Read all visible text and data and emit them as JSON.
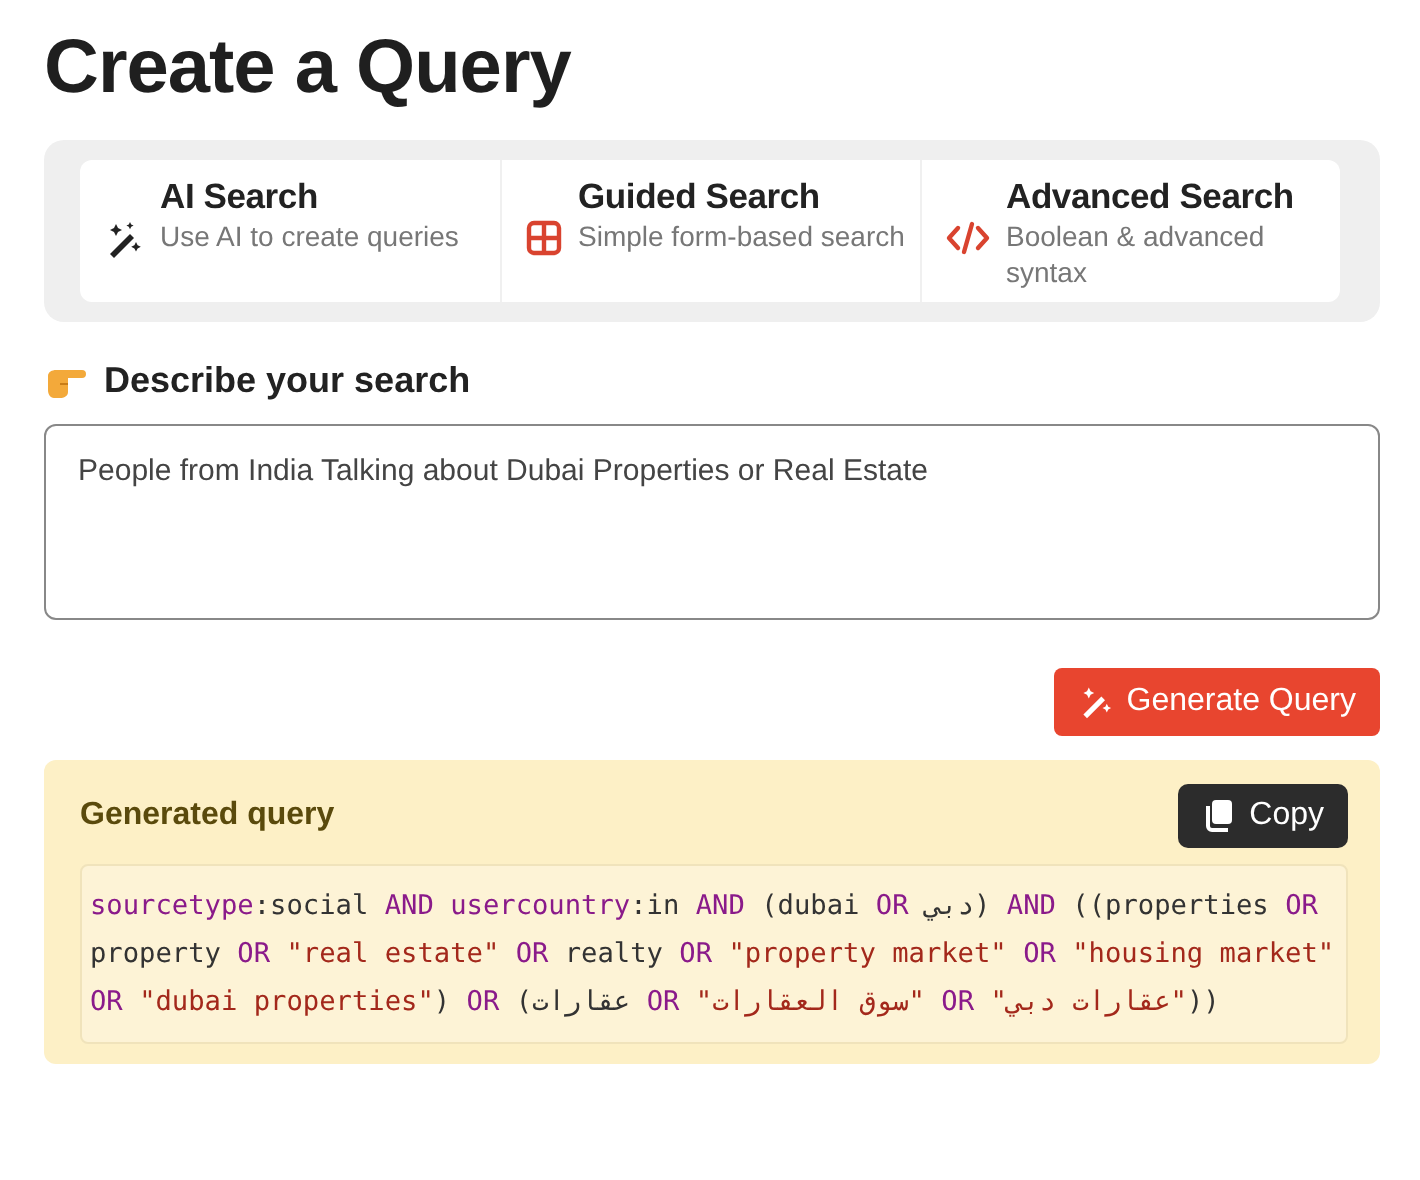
{
  "title": "Create a Query",
  "modes": [
    {
      "kind": "ai",
      "title": "AI Search",
      "subtitle": "Use AI to create queries"
    },
    {
      "kind": "guided",
      "title": "Guided Search",
      "subtitle": "Simple form-based search"
    },
    {
      "kind": "advanced",
      "title": "Advanced Search",
      "subtitle": "Boolean & advanced syntax"
    }
  ],
  "describe": {
    "label": "Describe your search",
    "value": "People from India Talking about Dubai Properties or Real Estate"
  },
  "generate_button": "Generate Query",
  "result": {
    "heading": "Generated query",
    "copy_button": "Copy",
    "tokens": [
      {
        "kind": "keyword",
        "text": "sourcetype"
      },
      {
        "kind": "plain",
        "text": ":social "
      },
      {
        "kind": "keyword",
        "text": "AND "
      },
      {
        "kind": "keyword",
        "text": "usercountry"
      },
      {
        "kind": "plain",
        "text": ":in "
      },
      {
        "kind": "keyword",
        "text": "AND "
      },
      {
        "kind": "plain",
        "text": "(dubai "
      },
      {
        "kind": "keyword",
        "text": "OR "
      },
      {
        "kind": "plain",
        "text": "دبي) "
      },
      {
        "kind": "keyword",
        "text": "AND "
      },
      {
        "kind": "plain",
        "text": "((properties "
      },
      {
        "kind": "keyword",
        "text": "OR "
      },
      {
        "kind": "plain",
        "text": "property "
      },
      {
        "kind": "keyword",
        "text": "OR "
      },
      {
        "kind": "string",
        "text": "\"real estate\" "
      },
      {
        "kind": "keyword",
        "text": "OR "
      },
      {
        "kind": "plain",
        "text": "realty "
      },
      {
        "kind": "keyword",
        "text": "OR "
      },
      {
        "kind": "string",
        "text": "\"property market\" "
      },
      {
        "kind": "keyword",
        "text": "OR "
      },
      {
        "kind": "string",
        "text": "\"housing market\" "
      },
      {
        "kind": "keyword",
        "text": "OR "
      },
      {
        "kind": "string",
        "text": "\"dubai properties\""
      },
      {
        "kind": "plain",
        "text": ") "
      },
      {
        "kind": "keyword",
        "text": "OR "
      },
      {
        "kind": "plain",
        "text": "(عقارات "
      },
      {
        "kind": "keyword",
        "text": "OR "
      },
      {
        "kind": "string",
        "text": "\"سوق العقارات\" "
      },
      {
        "kind": "keyword",
        "text": "OR "
      },
      {
        "kind": "string",
        "text": "\"عقارات دبي\""
      },
      {
        "kind": "plain",
        "text": "))"
      }
    ]
  }
}
